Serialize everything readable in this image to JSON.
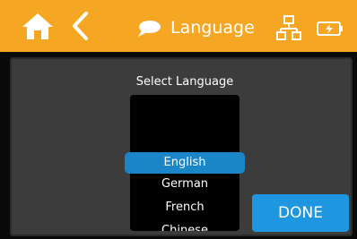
{
  "header": {
    "title": "Language",
    "icons": [
      "home-icon",
      "back-icon",
      "chat-icon",
      "network-icon",
      "battery-icon"
    ],
    "background_color": "#f5a623"
  },
  "language_picker": {
    "label": "Select Language",
    "options": [
      "English",
      "German",
      "French",
      "Chinese"
    ],
    "selected": "English",
    "highlight_color": "#1a86c8"
  },
  "done_button": {
    "label": "DONE",
    "color": "#1f96e0"
  }
}
